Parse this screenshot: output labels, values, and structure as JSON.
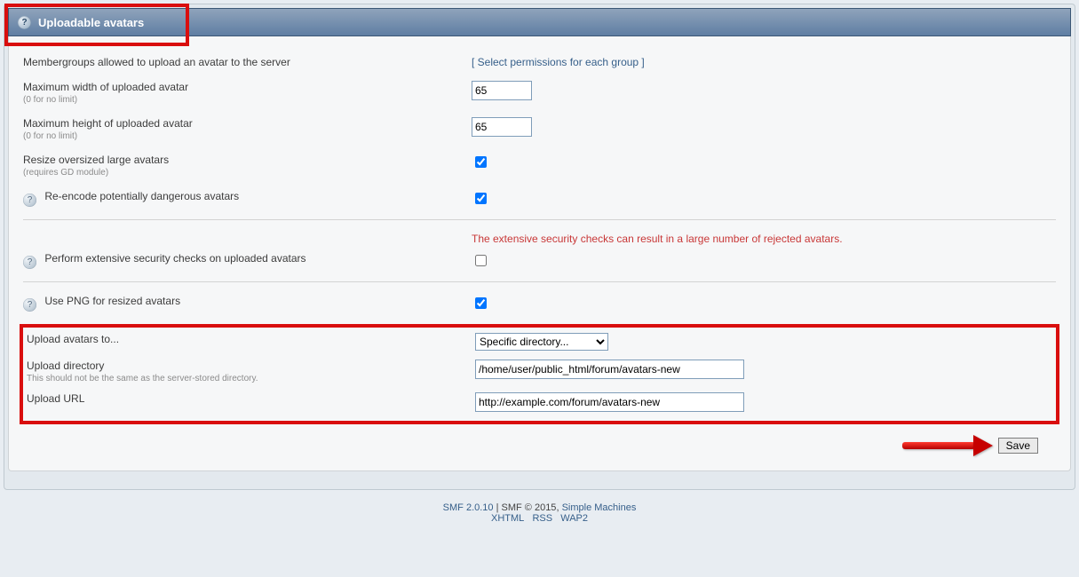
{
  "header": {
    "title": "Uploadable avatars"
  },
  "fields": {
    "membergroups": {
      "label": "Membergroups allowed to upload an avatar to the server",
      "link": "[ Select permissions for each group ]"
    },
    "max_width": {
      "label": "Maximum width of uploaded avatar",
      "sub": "(0 for no limit)",
      "value": "65"
    },
    "max_height": {
      "label": "Maximum height of uploaded avatar",
      "sub": "(0 for no limit)",
      "value": "65"
    },
    "resize": {
      "label": "Resize oversized large avatars",
      "sub": "(requires GD module)",
      "checked": true
    },
    "reencode": {
      "label": "Re-encode potentially dangerous avatars",
      "checked": true
    },
    "extensive": {
      "label": "Perform extensive security checks on uploaded avatars",
      "warn": "The extensive security checks can result in a large number of rejected avatars.",
      "checked": false
    },
    "png": {
      "label": "Use PNG for resized avatars",
      "checked": true
    },
    "upload_to": {
      "label": "Upload avatars to...",
      "value": "Specific directory..."
    },
    "upload_dir": {
      "label": "Upload directory",
      "sub": "This should not be the same as the server-stored directory.",
      "value": "/home/user/public_html/forum/avatars-new"
    },
    "upload_url": {
      "label": "Upload URL",
      "value": "http://example.com/forum/avatars-new"
    }
  },
  "buttons": {
    "save": "Save"
  },
  "footer": {
    "line1_a": "SMF 2.0.10",
    "sep": " | ",
    "line1_b": "SMF © 2015",
    "comma": ", ",
    "line1_c": "Simple Machines",
    "l2a": "XHTML",
    "l2b": "RSS",
    "l2c": "WAP2"
  }
}
